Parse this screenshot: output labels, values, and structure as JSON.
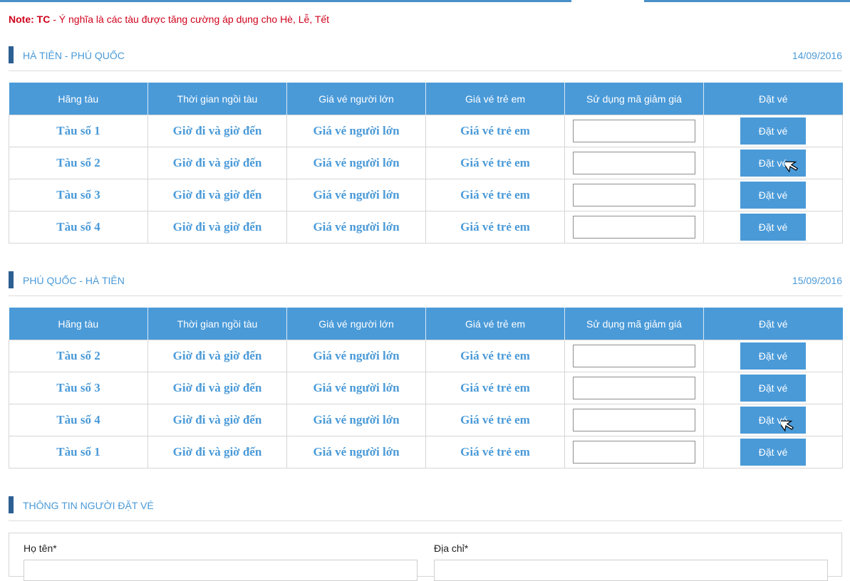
{
  "note": {
    "prefix": "Note: TC",
    "text": " - Ý nghĩa là các tàu được tăng cường áp dụng cho Hè, Lễ, Tết"
  },
  "columns": [
    "Hãng tàu",
    "Thời gian ngồi tàu",
    "Giá vé người lớn",
    "Giá vé trẻ em",
    "Sử dụng mã giảm giá",
    "Đặt vé"
  ],
  "routes": [
    {
      "title": "HÀ TIÊN - PHÚ QUỐC",
      "date": "14/09/2016",
      "rows": [
        {
          "ship": "Tàu số 1",
          "time": "Giờ đi và giờ đến",
          "adult": "Giá vé người lớn",
          "child": "Giá vé trẻ em",
          "button": "Đặt vé"
        },
        {
          "ship": "Tàu số 2",
          "time": "Giờ đi và giờ đến",
          "adult": "Giá vé người lớn",
          "child": "Giá vé trẻ em",
          "button": "Đặt vé"
        },
        {
          "ship": "Tàu số 3",
          "time": "Giờ đi và giờ đến",
          "adult": "Giá vé người lớn",
          "child": "Giá vé trẻ em",
          "button": "Đặt vé"
        },
        {
          "ship": "Tàu số 4",
          "time": "Giờ đi và giờ đến",
          "adult": "Giá vé người lớn",
          "child": "Giá vé trẻ em",
          "button": "Đặt vé"
        }
      ]
    },
    {
      "title": "PHÚ QUỐC - HÀ TIÊN",
      "date": "15/09/2016",
      "rows": [
        {
          "ship": "Tàu số 2",
          "time": "Giờ đi và giờ đến",
          "adult": "Giá vé người lớn",
          "child": "Giá vé trẻ em",
          "button": "Đặt vé"
        },
        {
          "ship": "Tàu số 3",
          "time": "Giờ đi và giờ đến",
          "adult": "Giá vé người lớn",
          "child": "Giá vé trẻ em",
          "button": "Đặt vé"
        },
        {
          "ship": "Tàu số 4",
          "time": "Giờ đi và giờ đến",
          "adult": "Giá vé người lớn",
          "child": "Giá vé trẻ em",
          "button": "Đặt vé"
        },
        {
          "ship": "Tàu số 1",
          "time": "Giờ đi và giờ đến",
          "adult": "Giá vé người lớn",
          "child": "Giá vé trẻ em",
          "button": "Đặt vé"
        }
      ]
    }
  ],
  "booker": {
    "title": "THÔNG TIN NGƯỜI ĐẶT VÉ",
    "name_label": "Họ tên*",
    "address_label": "Địa chỉ*"
  },
  "colors": {
    "accent": "#4a9ad8",
    "header_bar": "#2d5f93",
    "note": "#d0021b"
  }
}
